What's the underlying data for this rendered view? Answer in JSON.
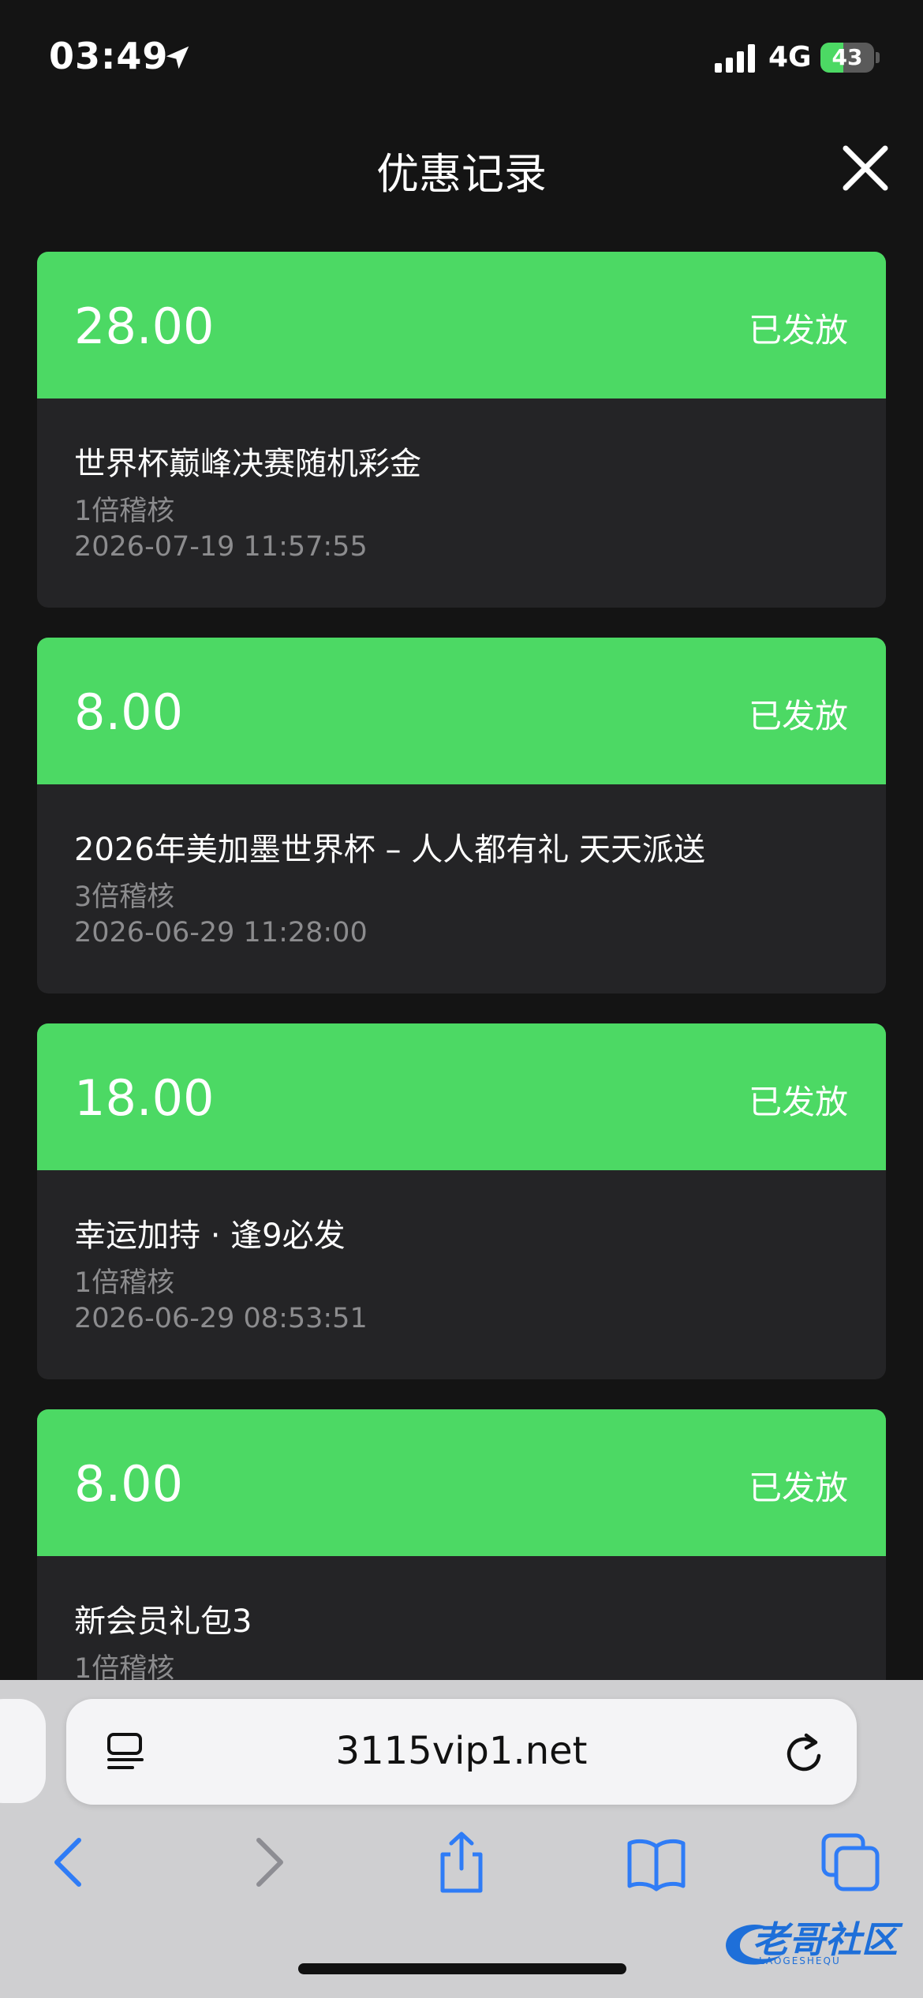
{
  "status_bar": {
    "time": "03:49",
    "network": "4G",
    "battery_level": "43",
    "battery_fraction": 0.43
  },
  "header": {
    "title": "优惠记录"
  },
  "records": [
    {
      "amount": "28.00",
      "status": "已发放",
      "title": "世界杯巅峰决赛随机彩金",
      "multiplier": "1倍稽核",
      "date": "2026-07-19 11:57:55"
    },
    {
      "amount": "8.00",
      "status": "已发放",
      "title": "2026年美加墨世界杯 – 人人都有礼 天天派送",
      "multiplier": "3倍稽核",
      "date": "2026-06-29 11:28:00"
    },
    {
      "amount": "18.00",
      "status": "已发放",
      "title": "幸运加持 · 逢9必发",
      "multiplier": "1倍稽核",
      "date": "2026-06-29 08:53:51"
    },
    {
      "amount": "8.00",
      "status": "已发放",
      "title": "新会员礼包3",
      "multiplier": "1倍稽核",
      "date": ""
    }
  ],
  "browser": {
    "url": "3115vip1.net"
  },
  "watermark": {
    "text": "老哥社区",
    "sub": "LAOGESHEQU"
  },
  "colors": {
    "accent_green": "#4cd964",
    "ios_blue": "#2f7cf6",
    "background": "#141414",
    "card": "#242426"
  }
}
